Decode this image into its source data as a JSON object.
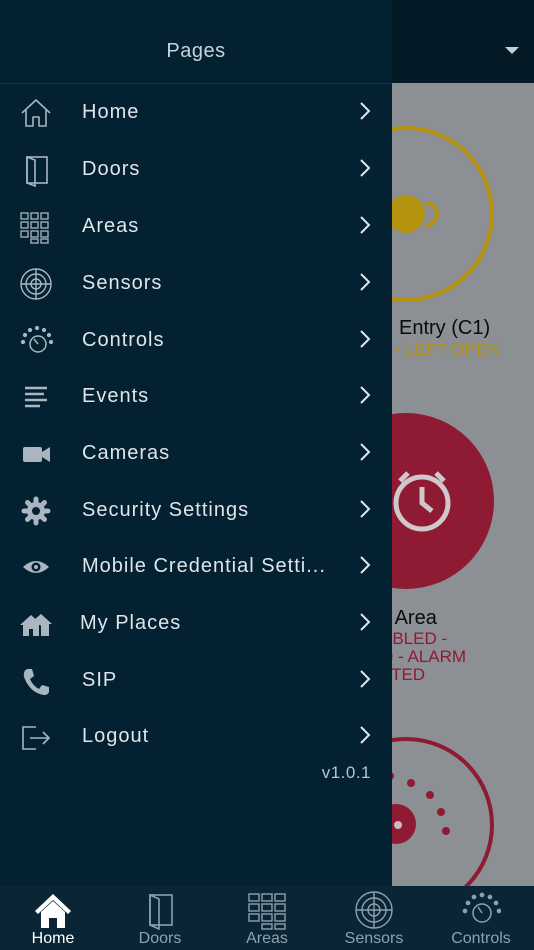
{
  "drawer": {
    "title": "Pages",
    "version": "v1.0.1",
    "items": [
      {
        "label": "Home",
        "icon": "home-icon"
      },
      {
        "label": "Doors",
        "icon": "door-icon"
      },
      {
        "label": "Areas",
        "icon": "areas-grid-icon"
      },
      {
        "label": "Sensors",
        "icon": "radar-icon"
      },
      {
        "label": "Controls",
        "icon": "knob-icon"
      },
      {
        "label": "Events",
        "icon": "list-icon"
      },
      {
        "label": "Cameras",
        "icon": "video-camera-icon"
      },
      {
        "label": "Security Settings",
        "icon": "gear-icon"
      },
      {
        "label": "Mobile Credential Setti...",
        "icon": "eye-icon"
      },
      {
        "label": "My Places",
        "icon": "houses-icon"
      },
      {
        "label": "SIP",
        "icon": "phone-icon"
      },
      {
        "label": "Logout",
        "icon": "logout-icon"
      }
    ]
  },
  "background": {
    "door_card": {
      "name": "Entry (C1)",
      "status": "- LEFT OPEN",
      "color": "#b5930f"
    },
    "area_card": {
      "name": "n Area",
      "status_lines": [
        "ABLED -",
        "D - ALARM",
        "ATED"
      ],
      "color": "#8f1a33"
    },
    "sensor_card": {
      "color": "#8f1a33"
    }
  },
  "tabbar": {
    "active": "Home",
    "tabs": [
      {
        "label": "Home",
        "icon": "home-icon"
      },
      {
        "label": "Doors",
        "icon": "door-icon"
      },
      {
        "label": "Areas",
        "icon": "areas-grid-icon"
      },
      {
        "label": "Sensors",
        "icon": "radar-icon"
      },
      {
        "label": "Controls",
        "icon": "knob-icon"
      }
    ]
  },
  "colors": {
    "drawer_bg": "#042132",
    "tabbar_bg": "#0a2636",
    "text": "#dfe5e9",
    "icon": "#aab6bf",
    "warning": "#b5930f",
    "alarm": "#8f1a33"
  }
}
